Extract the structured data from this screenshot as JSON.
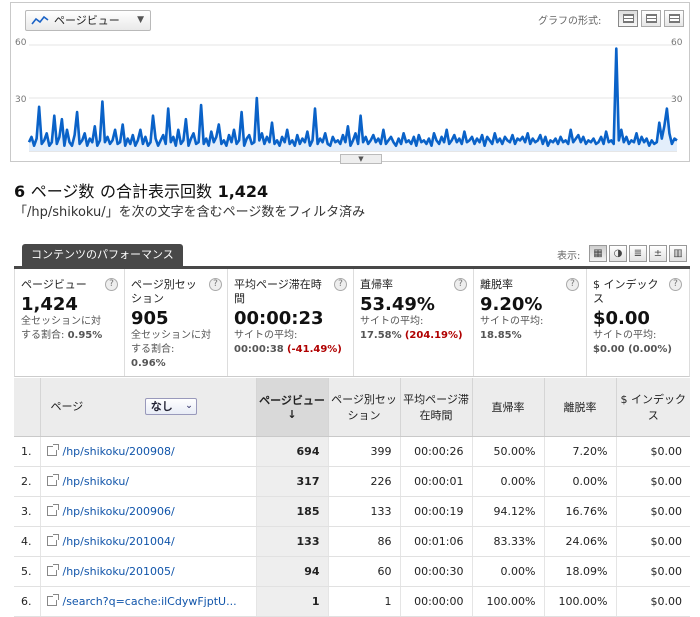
{
  "chart": {
    "metric_selector": "ページビュー",
    "graph_format_label": "グラフの形式:",
    "y_axis_left": [
      "60",
      "30"
    ],
    "y_axis_right": [
      "60",
      "30"
    ],
    "line_color": "#0a62c8",
    "fill_color": "#e3eefb",
    "series": [
      5,
      8,
      3,
      7,
      25,
      4,
      6,
      10,
      3,
      5,
      20,
      4,
      8,
      18,
      3,
      12,
      5,
      3,
      9,
      22,
      4,
      6,
      10,
      3,
      7,
      5,
      14,
      3,
      6,
      28,
      5,
      8,
      4,
      6,
      12,
      4,
      5,
      15,
      3,
      7,
      4,
      9,
      3,
      6,
      12,
      4,
      8,
      3,
      5,
      20,
      7,
      3,
      6,
      9,
      4,
      24,
      5,
      8,
      3,
      12,
      4,
      6,
      18,
      3,
      7,
      10,
      4,
      5,
      26,
      4,
      7,
      3,
      11,
      5,
      8,
      15,
      4,
      6,
      3,
      9,
      5,
      12,
      4,
      6,
      22,
      3,
      7,
      9,
      4,
      5,
      30,
      6,
      10,
      4,
      8,
      5,
      16,
      4,
      6,
      3,
      8,
      5,
      12,
      4,
      6,
      3,
      9,
      4,
      7,
      5,
      11,
      3,
      6,
      24,
      4,
      7,
      5,
      10,
      4,
      3,
      8,
      5,
      6,
      4,
      9,
      5,
      14,
      3,
      6,
      10,
      4,
      20,
      5,
      8,
      4,
      6,
      9,
      5,
      7,
      4,
      12,
      4,
      6,
      8,
      5,
      3,
      7,
      4,
      10,
      5,
      6,
      4,
      8,
      3,
      9,
      5,
      6,
      4,
      7,
      3,
      10,
      6,
      4,
      8,
      5,
      12,
      4,
      6,
      9,
      5,
      7,
      4,
      11,
      5,
      6,
      8,
      4,
      7,
      5,
      9,
      3,
      8,
      6,
      4,
      10,
      5,
      7,
      4,
      8,
      6,
      5,
      9,
      4,
      7,
      6,
      8,
      5,
      10,
      4,
      7,
      5,
      6,
      9,
      4,
      8,
      3,
      6,
      5,
      7,
      4,
      8,
      5,
      6,
      4,
      12,
      5,
      7,
      9,
      5,
      8,
      4,
      6,
      5,
      7,
      4,
      5,
      8,
      4,
      11,
      5,
      6,
      4,
      58,
      6,
      12,
      5,
      8,
      4,
      6,
      5,
      10,
      4,
      8,
      5,
      7,
      3,
      6,
      4,
      5,
      16,
      7,
      14,
      24,
      10,
      4,
      7,
      6
    ]
  },
  "summary": {
    "count": "6",
    "text1": "ページ数",
    "text2": "の合計表示回数",
    "total": "1,424",
    "filter_note": "「/hp/shikoku/」を次の文字を含むページ数をフィルタ済み"
  },
  "tab": {
    "label": "コンテンツのパフォーマンス"
  },
  "view": {
    "label": "表示:"
  },
  "cards": [
    {
      "label": "ページビュー",
      "value": "1,424",
      "sub1": "全セッションに対",
      "sub2": "する割合:",
      "sub2b": "0.95%"
    },
    {
      "label": "ページ別セッション",
      "value": "905",
      "sub1": "全セッションに対",
      "sub2": "する割合:",
      "sub2b": "0.96%"
    },
    {
      "label": "平均ページ滞在時間",
      "value": "00:00:23",
      "sub1": "サイトの平均:",
      "sub2b": "00:00:38",
      "delta": "(-41.49%)"
    },
    {
      "label": "直帰率",
      "value": "53.49%",
      "sub1": "サイトの平均:",
      "sub2b": "17.58%",
      "delta": "(204.19%)"
    },
    {
      "label": "離脱率",
      "value": "9.20%",
      "sub1": "サイトの平均:",
      "sub2b": "18.85%"
    },
    {
      "label": "$ インデックス",
      "value": "$0.00",
      "sub1": "サイトの平均:",
      "sub2b": "$0.00 (0.00%)"
    }
  ],
  "table": {
    "headers": {
      "page": "ページ",
      "dimension": "なし",
      "pageviews": "ページビュー",
      "sessions": "ページ別セッション",
      "avg_time": "平均ページ滞在時間",
      "bounce": "直帰率",
      "exit": "離脱率",
      "index": "$ インデックス"
    },
    "rows": [
      {
        "n": "1.",
        "page": "/hp/shikoku/200908/",
        "pv": "694",
        "sess": "399",
        "time": "00:00:26",
        "bounce": "50.00%",
        "exit": "7.20%",
        "idx": "$0.00"
      },
      {
        "n": "2.",
        "page": "/hp/shikoku/",
        "pv": "317",
        "sess": "226",
        "time": "00:00:01",
        "bounce": "0.00%",
        "exit": "0.00%",
        "idx": "$0.00"
      },
      {
        "n": "3.",
        "page": "/hp/shikoku/200906/",
        "pv": "185",
        "sess": "133",
        "time": "00:00:19",
        "bounce": "94.12%",
        "exit": "16.76%",
        "idx": "$0.00"
      },
      {
        "n": "4.",
        "page": "/hp/shikoku/201004/",
        "pv": "133",
        "sess": "86",
        "time": "00:01:06",
        "bounce": "83.33%",
        "exit": "24.06%",
        "idx": "$0.00"
      },
      {
        "n": "5.",
        "page": "/hp/shikoku/201005/",
        "pv": "94",
        "sess": "60",
        "time": "00:00:30",
        "bounce": "0.00%",
        "exit": "18.09%",
        "idx": "$0.00"
      },
      {
        "n": "6.",
        "page": "/search?q=cache:ilCdywFjptU...",
        "pv": "1",
        "sess": "1",
        "time": "00:00:00",
        "bounce": "100.00%",
        "exit": "100.00%",
        "idx": "$0.00"
      }
    ]
  }
}
